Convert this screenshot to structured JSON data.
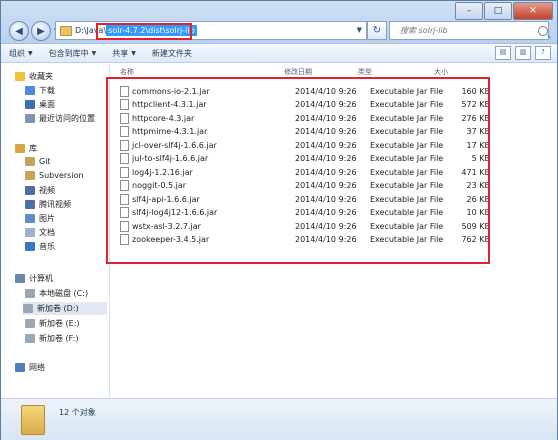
{
  "window": {
    "controls": [
      "–",
      "□",
      "✕"
    ]
  },
  "address": {
    "prefix": "D:\\Java",
    "path": "solr-4.7.2\\dist\\solrj-lib"
  },
  "search": {
    "placeholder": "搜索 solrj-lib"
  },
  "toolbar": {
    "organize": "组织",
    "include_library": "包含到库中",
    "share": "共享",
    "new_folder": "新建文件夹"
  },
  "nav": {
    "favorites": "收藏夹",
    "downloads": "下载",
    "desktop": "桌面",
    "recent": "最近访问的位置",
    "libraries": "库",
    "git": "Git",
    "subversion": "Subversion",
    "videos": "视频",
    "tencent_video": "腾讯视频",
    "pictures": "图片",
    "documents": "文档",
    "music": "音乐",
    "computer": "计算机",
    "local_c": "本地磁盘 (C:)",
    "drive_d": "新加卷 (D:)",
    "drive_e": "新加卷 (E:)",
    "drive_f": "新加卷 (F:)",
    "network": "网络"
  },
  "columns": {
    "name": "名称",
    "modified": "修改日期",
    "type": "类型",
    "size": "大小"
  },
  "files": [
    {
      "name": "commons-io-2.1.jar",
      "date": "2014/4/10 9:26",
      "type": "Executable Jar File",
      "size": "160 KB"
    },
    {
      "name": "httpclient-4.3.1.jar",
      "date": "2014/4/10 9:26",
      "type": "Executable Jar File",
      "size": "572 KB"
    },
    {
      "name": "httpcore-4.3.jar",
      "date": "2014/4/10 9:26",
      "type": "Executable Jar File",
      "size": "276 KB"
    },
    {
      "name": "httpmime-4.3.1.jar",
      "date": "2014/4/10 9:26",
      "type": "Executable Jar File",
      "size": "37 KB"
    },
    {
      "name": "jcl-over-slf4j-1.6.6.jar",
      "date": "2014/4/10 9:26",
      "type": "Executable Jar File",
      "size": "17 KB"
    },
    {
      "name": "jul-to-slf4j-1.6.6.jar",
      "date": "2014/4/10 9:26",
      "type": "Executable Jar File",
      "size": "5 KB"
    },
    {
      "name": "log4j-1.2.16.jar",
      "date": "2014/4/10 9:26",
      "type": "Executable Jar File",
      "size": "471 KB"
    },
    {
      "name": "noggit-0.5.jar",
      "date": "2014/4/10 9:26",
      "type": "Executable Jar File",
      "size": "23 KB"
    },
    {
      "name": "slf4j-api-1.6.6.jar",
      "date": "2014/4/10 9:26",
      "type": "Executable Jar File",
      "size": "26 KB"
    },
    {
      "name": "slf4j-log4j12-1.6.6.jar",
      "date": "2014/4/10 9:26",
      "type": "Executable Jar File",
      "size": "10 KB"
    },
    {
      "name": "wstx-asl-3.2.7.jar",
      "date": "2014/4/10 9:26",
      "type": "Executable Jar File",
      "size": "509 KB"
    },
    {
      "name": "zookeeper-3.4.5.jar",
      "date": "2014/4/10 9:26",
      "type": "Executable Jar File",
      "size": "762 KB"
    }
  ],
  "status": {
    "count_text": "12 个对象"
  }
}
